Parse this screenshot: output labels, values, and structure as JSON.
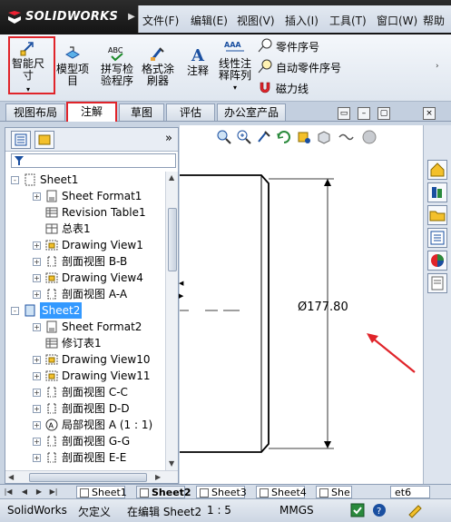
{
  "app": {
    "name": "SOLIDWORKS"
  },
  "menus": [
    "文件(F)",
    "编辑(E)",
    "视图(V)",
    "插入(I)",
    "工具(T)",
    "窗口(W)",
    "帮助"
  ],
  "ribbon": {
    "smart_dimension": "智能尺\n寸",
    "model_items": "模型项\n目",
    "spell_checker": "拼写检\n验程序",
    "format_painter": "格式涂\n刷器",
    "note": "注释",
    "linear_note_pattern": "线性注\n释阵列",
    "balloon": "零件序号",
    "auto_balloon": "自动零件序号",
    "magnetic_line": "磁力线"
  },
  "tabs": [
    "视图布局",
    "注解",
    "草图",
    "评估",
    "办公室产品"
  ],
  "tree": [
    {
      "label": "Sheet1",
      "level": 0,
      "exp": "-",
      "icon": "sheet-icon"
    },
    {
      "label": "Sheet Format1",
      "level": 1,
      "exp": "+",
      "icon": "sheet-format-icon"
    },
    {
      "label": "Revision Table1",
      "level": 1,
      "exp": "",
      "icon": "revision-table-icon"
    },
    {
      "label": "总表1",
      "level": 1,
      "exp": "",
      "icon": "table-icon"
    },
    {
      "label": "Drawing View1",
      "level": 1,
      "exp": "+",
      "icon": "drawing-view-icon"
    },
    {
      "label": "剖面视图 B-B",
      "level": 1,
      "exp": "+",
      "icon": "section-view-icon"
    },
    {
      "label": "Drawing View4",
      "level": 1,
      "exp": "+",
      "icon": "drawing-view-icon"
    },
    {
      "label": "剖面视图 A-A",
      "level": 1,
      "exp": "+",
      "icon": "section-view-icon"
    },
    {
      "label": "Sheet2",
      "level": 0,
      "exp": "-",
      "icon": "sheet-active-icon",
      "selected": true
    },
    {
      "label": "Sheet Format2",
      "level": 1,
      "exp": "+",
      "icon": "sheet-format-icon"
    },
    {
      "label": "修订表1",
      "level": 1,
      "exp": "",
      "icon": "revision-table-icon"
    },
    {
      "label": "Drawing View10",
      "level": 1,
      "exp": "+",
      "icon": "drawing-view-icon"
    },
    {
      "label": "Drawing View11",
      "level": 1,
      "exp": "+",
      "icon": "drawing-view-icon"
    },
    {
      "label": "剖面视图 C-C",
      "level": 1,
      "exp": "+",
      "icon": "section-view-icon"
    },
    {
      "label": "剖面视图 D-D",
      "level": 1,
      "exp": "+",
      "icon": "section-view-icon"
    },
    {
      "label": "局部视图 A (1 : 1)",
      "level": 1,
      "exp": "+",
      "icon": "detail-view-icon"
    },
    {
      "label": "剖面视图 G-G",
      "level": 1,
      "exp": "+",
      "icon": "section-view-icon"
    },
    {
      "label": "剖面视图 E-E",
      "level": 1,
      "exp": "+",
      "icon": "section-view-icon"
    }
  ],
  "drawing": {
    "dimension": "Ø177.80"
  },
  "sheet_tabs": [
    "Sheet1",
    "Sheet2",
    "Sheet3",
    "Sheet4",
    "She",
    "et6"
  ],
  "status": {
    "app": "SolidWorks",
    "state": "欠定义",
    "editing": "在编辑 Sheet2",
    "scale": "1 : 5",
    "units": "MMGS"
  },
  "colors": {
    "highlight_red": "#e0242a",
    "selection_blue": "#3399ff"
  }
}
